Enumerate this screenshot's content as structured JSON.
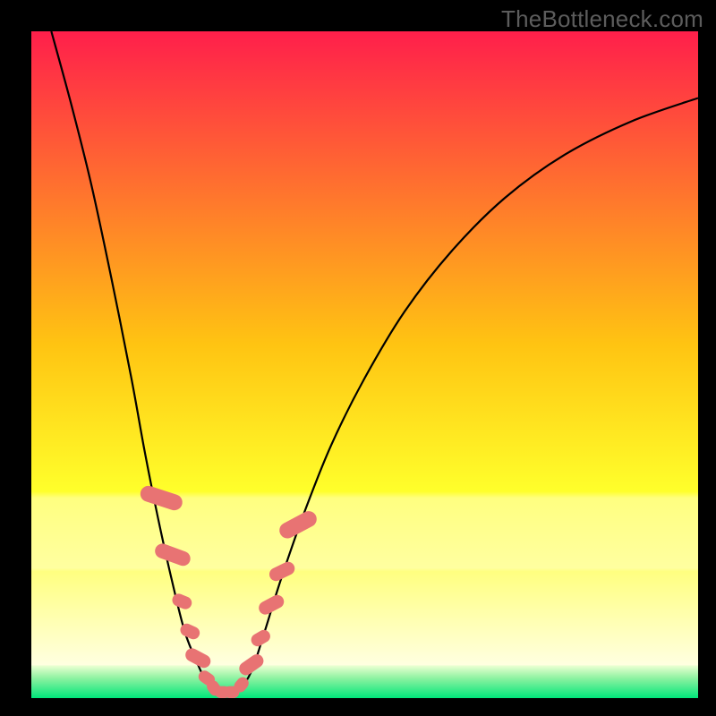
{
  "watermark": "TheBottleneck.com",
  "chart_data": {
    "type": "line",
    "title": "",
    "xlabel": "",
    "ylabel": "",
    "xlim": [
      0,
      100
    ],
    "ylim": [
      0,
      100
    ],
    "gradient_bands": [
      {
        "position": 0.0,
        "color": "#ff1f4b"
      },
      {
        "position": 0.47,
        "color": "#ffc412"
      },
      {
        "position": 0.69,
        "color": "#ffff2b"
      },
      {
        "position": 0.7,
        "color": "#ffff80"
      },
      {
        "position": 0.805,
        "color": "#ffffa0"
      },
      {
        "position": 0.81,
        "color": "#ffff80"
      },
      {
        "position": 0.95,
        "color": "#ffffe0"
      },
      {
        "position": 0.952,
        "color": "#e7ffd0"
      },
      {
        "position": 0.97,
        "color": "#8ef2a1"
      },
      {
        "position": 1.0,
        "color": "#00e67a"
      }
    ],
    "series": [
      {
        "name": "curve",
        "color": "#000000",
        "points": [
          {
            "x": 3.0,
            "y": 100.0
          },
          {
            "x": 6.0,
            "y": 89.0
          },
          {
            "x": 9.0,
            "y": 77.0
          },
          {
            "x": 12.0,
            "y": 63.0
          },
          {
            "x": 15.0,
            "y": 48.0
          },
          {
            "x": 17.0,
            "y": 37.0
          },
          {
            "x": 19.0,
            "y": 27.0
          },
          {
            "x": 21.0,
            "y": 18.0
          },
          {
            "x": 23.0,
            "y": 10.0
          },
          {
            "x": 25.0,
            "y": 5.0
          },
          {
            "x": 26.5,
            "y": 2.0
          },
          {
            "x": 28.0,
            "y": 0.8
          },
          {
            "x": 29.5,
            "y": 0.5
          },
          {
            "x": 31.0,
            "y": 1.0
          },
          {
            "x": 33.0,
            "y": 4.0
          },
          {
            "x": 35.0,
            "y": 10.0
          },
          {
            "x": 37.5,
            "y": 18.0
          },
          {
            "x": 41.0,
            "y": 28.0
          },
          {
            "x": 45.0,
            "y": 38.0
          },
          {
            "x": 50.0,
            "y": 48.0
          },
          {
            "x": 56.0,
            "y": 58.0
          },
          {
            "x": 63.0,
            "y": 67.0
          },
          {
            "x": 71.0,
            "y": 75.0
          },
          {
            "x": 80.0,
            "y": 81.5
          },
          {
            "x": 90.0,
            "y": 86.5
          },
          {
            "x": 100.0,
            "y": 90.0
          }
        ]
      }
    ],
    "markers": {
      "name": "highlight-beads",
      "color": "#e87373",
      "shape": "rounded-rect",
      "points": [
        {
          "x": 19.5,
          "y": 30.0,
          "w": 2.4,
          "h": 6.5,
          "angle": -72
        },
        {
          "x": 21.2,
          "y": 21.5,
          "w": 2.2,
          "h": 5.5,
          "angle": -70
        },
        {
          "x": 22.6,
          "y": 14.5,
          "w": 1.9,
          "h": 3.0,
          "angle": -68
        },
        {
          "x": 23.8,
          "y": 10.0,
          "w": 1.9,
          "h": 3.0,
          "angle": -66
        },
        {
          "x": 25.0,
          "y": 6.0,
          "w": 2.0,
          "h": 4.0,
          "angle": -62
        },
        {
          "x": 26.3,
          "y": 3.0,
          "w": 1.8,
          "h": 2.6,
          "angle": -55
        },
        {
          "x": 27.4,
          "y": 1.5,
          "w": 1.8,
          "h": 2.4,
          "angle": -35
        },
        {
          "x": 28.7,
          "y": 0.9,
          "w": 2.4,
          "h": 1.8,
          "angle": 0
        },
        {
          "x": 30.0,
          "y": 0.9,
          "w": 2.4,
          "h": 1.8,
          "angle": 0
        },
        {
          "x": 31.5,
          "y": 2.0,
          "w": 1.8,
          "h": 2.4,
          "angle": 40
        },
        {
          "x": 33.0,
          "y": 5.0,
          "w": 2.0,
          "h": 4.0,
          "angle": 55
        },
        {
          "x": 34.4,
          "y": 9.0,
          "w": 1.9,
          "h": 3.0,
          "angle": 60
        },
        {
          "x": 36.0,
          "y": 14.0,
          "w": 2.0,
          "h": 4.0,
          "angle": 62
        },
        {
          "x": 37.6,
          "y": 19.0,
          "w": 2.0,
          "h": 4.0,
          "angle": 64
        },
        {
          "x": 40.0,
          "y": 26.0,
          "w": 2.4,
          "h": 6.0,
          "angle": 62
        }
      ]
    }
  }
}
